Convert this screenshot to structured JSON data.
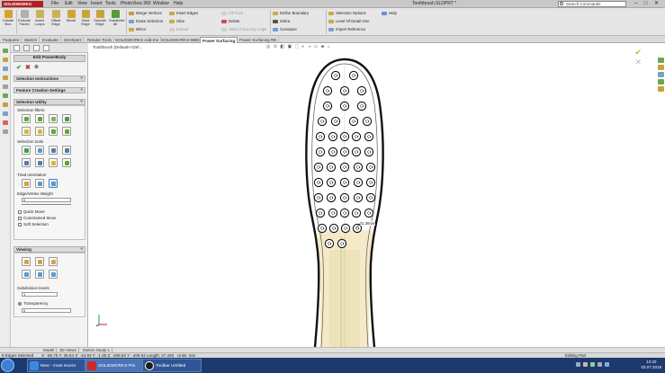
{
  "app": {
    "logo": "SOLIDWORKS",
    "document_title": "Toothbrush.SLDPRT *",
    "menus": [
      "File",
      "Edit",
      "View",
      "Insert",
      "Tools",
      "PhotoView 360",
      "Window",
      "Help"
    ],
    "search_placeholder": "Search Commands",
    "window_controls": [
      "–",
      "□",
      "✕"
    ]
  },
  "ribbon": {
    "big_buttons": [
      {
        "label": "Create Box",
        "color": "#d9a12c"
      },
      {
        "label": "Extrude Faces",
        "color": "#b0b0b0"
      },
      {
        "label": "Insert Loops",
        "color": "#c8b25a"
      },
      {
        "label": "Offset Edge",
        "color": "#c8b25a"
      },
      {
        "label": "Bevel",
        "color": "#d3a33a"
      },
      {
        "label": "Hard Edge",
        "color": "#c7a440"
      },
      {
        "label": "Smooth Edge",
        "color": "#c7a440"
      },
      {
        "label": "Subdivide All",
        "color": "#5b9a3a"
      }
    ],
    "group1": [
      {
        "label": "Merge Vertices",
        "dim": false
      },
      {
        "label": "Erase Selection",
        "dim": false
      },
      {
        "label": "Mirror",
        "dim": false
      }
    ],
    "group2": [
      {
        "label": "Insert Edges",
        "dim": false
      },
      {
        "label": "Slice",
        "dim": false
      },
      {
        "label": "Extend",
        "dim": true
      }
    ],
    "group3": [
      {
        "label": "Fill Face",
        "dim": true
      },
      {
        "label": "Delete",
        "dim": false
      },
      {
        "label": "Select Faces by Angle",
        "dim": true
      }
    ],
    "group4": [
      {
        "label": "Define Boundary",
        "dim": false
      },
      {
        "label": "Zebra",
        "dim": false
      },
      {
        "label": "Curvature",
        "dim": false
      }
    ],
    "group5": [
      {
        "label": "Selection Options",
        "dim": false
      },
      {
        "label": "Level Of Detail One",
        "dim": false
      },
      {
        "label": "Import Reference",
        "dim": false
      }
    ],
    "help_label": "Help"
  },
  "tabs": [
    "Features",
    "Sketch",
    "Evaluate",
    "DimXpert",
    "Render Tools",
    "SOLIDWORKS Add-Ins",
    "SOLIDWORKS MBD",
    "Power Surfacing",
    "Power Surfacing RE"
  ],
  "active_tab": "Power Surfacing",
  "property_manager": {
    "title": "Edit PowerBody",
    "ok_symbol": "✔",
    "cancel_symbol": "✖",
    "pin_symbol": "⊕",
    "sections": {
      "selection_instructions": "Selection Instructions",
      "feature_creation_settings": "Feature Creation Settings",
      "selection_utility": "Selection Utility",
      "viewing": "Viewing"
    },
    "selection_filters_label": "Selection filters",
    "selection_tools_label": "Selection tools",
    "triad_orientation_label": "Triad orientation",
    "edge_vertex_weight_label": "Edge/Vertex Weight",
    "edge_vertex_weight_value": "0",
    "checkboxes": [
      "Quick Move",
      "Constrained Move",
      "Soft Selection"
    ],
    "subdivision_levels_label": "Subdivision levels",
    "subdivision_value": "1",
    "transparency_label": "Transparency",
    "transparency_value": "0"
  },
  "graphics": {
    "tree_flyout": "Toothbrush (Default<<Def...",
    "dimension_label": "21.36mm"
  },
  "bottom_tabs": [
    "Model",
    "3D Views",
    "Motion Study 1"
  ],
  "active_bottom_tab": "Model",
  "status": {
    "selection": "8 Edges Selected",
    "coords": "X: -55.75 Y: 38.84  X: -44.93 Y: -1.28  Z: -408.63 Y: -409.63",
    "length": "Length: 27.428",
    "units": "Units: mm",
    "mode": "Editing Part"
  },
  "taskbar": {
    "apps": [
      {
        "label": "New - most recent",
        "color": "#3a8be0"
      },
      {
        "label": "SOLIDWORKS Pre",
        "color": "#c72b2b"
      },
      {
        "label": "Toolbar Untitled",
        "color": "#1d1d1d"
      }
    ],
    "time": "13:20",
    "date": "03.07.2018"
  }
}
